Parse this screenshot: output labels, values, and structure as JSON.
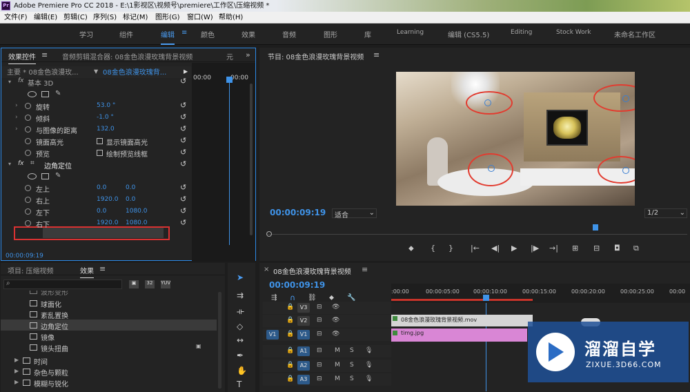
{
  "window": {
    "title": "Adobe Premiere Pro CC 2018 - E:\\1影视区\\视频号\\premiere\\工作区\\压缩视频 *",
    "app_icon": "Pr"
  },
  "menu": [
    "文件(F)",
    "编辑(E)",
    "剪辑(C)",
    "序列(S)",
    "标记(M)",
    "图形(G)",
    "窗口(W)",
    "帮助(H)"
  ],
  "workspaces": [
    "学习",
    "组件",
    "编辑",
    "颜色",
    "效果",
    "音频",
    "图形",
    "库",
    "Learning",
    "编辑 (CS5.5)",
    "Editing",
    "Stock Work",
    "未命名工作区"
  ],
  "active_workspace_index": 2,
  "effect_controls": {
    "tabs": [
      "效果控件",
      "音频剪辑混合器: 08金色浪漫玫瑰背景视频",
      "元"
    ],
    "master_label": "主要 * 08金色浪漫玫...",
    "clip_label": "08金色浪漫玫瑰背...",
    "times": [
      "00:00",
      "00:00"
    ],
    "section_basic3d": "基本 3D",
    "rows": {
      "rotate": {
        "label": "旋转",
        "value": "53.0 °"
      },
      "tilt": {
        "label": "倾斜",
        "value": "-1.0 °"
      },
      "distance": {
        "label": "与图像的距离",
        "value": "132.0"
      },
      "specular": {
        "label": "镜面高光",
        "checkbox": "显示镜面高光"
      },
      "preview": {
        "label": "预览",
        "checkbox": "绘制预览线框"
      },
      "cornerpin": {
        "label": "边角定位"
      },
      "ul": {
        "label": "左上",
        "x": "0.0",
        "y": "0.0"
      },
      "ur": {
        "label": "右上",
        "x": "1920.0",
        "y": "0.0"
      },
      "ll": {
        "label": "左下",
        "x": "0.0",
        "y": "1080.0"
      },
      "lr": {
        "label": "右下",
        "x": "1920.0",
        "y": "1080.0"
      }
    },
    "timecode": "00:00:09:19"
  },
  "program": {
    "title": "节目: 08金色浪漫玫瑰背景视频",
    "timecode": "00:00:09:19",
    "fit": "适合",
    "resolution": "1/2"
  },
  "project": {
    "tabs": [
      "项目: 压缩视频",
      "效果"
    ],
    "search_placeholder": "",
    "effects": [
      "球面化",
      "紊乱置换",
      "边角定位",
      "镜像",
      "镜头扭曲"
    ],
    "partial_top": "波形变形",
    "selected": "边角定位",
    "folders": [
      "时间",
      "杂色与颗粒",
      "模糊与锐化"
    ]
  },
  "timeline": {
    "title": "08金色浪漫玫瑰背景视频",
    "timecode": "00:00:09:19",
    "ruler": [
      ":00:00",
      "00:00:05:00",
      "00:00:10:00",
      "00:00:15:00",
      "00:00:20:00",
      "00:00:25:00",
      "00:00"
    ],
    "tracks": [
      {
        "name": "V3",
        "type": "video"
      },
      {
        "name": "V2",
        "type": "video"
      },
      {
        "name": "V1",
        "type": "video",
        "source": "V1"
      },
      {
        "name": "A1",
        "type": "audio"
      },
      {
        "name": "A2",
        "type": "audio"
      },
      {
        "name": "A3",
        "type": "audio"
      }
    ],
    "clips": {
      "v2": "08金色浪漫玫瑰背景视频.mov",
      "v1": "timg.jpg"
    },
    "m_label": "M",
    "s_label": "S"
  },
  "watermark": {
    "name": "溜溜自学",
    "url": "ZIXUE.3D66.COM"
  },
  "colors": {
    "accent": "#2d8ceb",
    "value_blue": "#3f93e8",
    "highlight_red": "#d93232",
    "clip_pink": "#d986d5"
  }
}
